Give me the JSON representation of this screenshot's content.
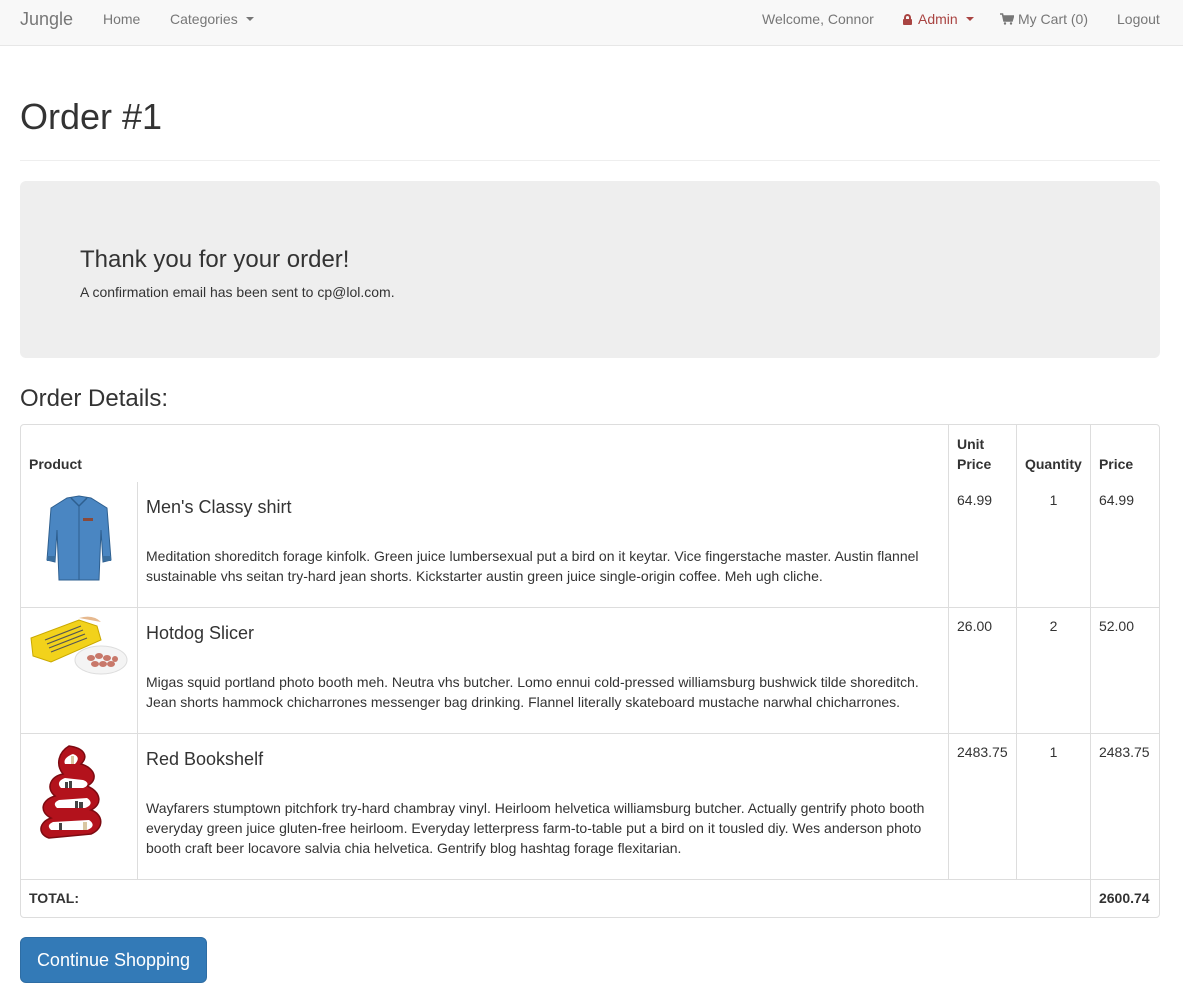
{
  "navbar": {
    "brand": "Jungle",
    "home": "Home",
    "categories": "Categories",
    "welcome": "Welcome, Connor",
    "admin": "Admin",
    "cart": "My Cart (0)",
    "logout": "Logout"
  },
  "page": {
    "title": "Order #1"
  },
  "jumbotron": {
    "title": "Thank you for your order!",
    "text": "A confirmation email has been sent to cp@lol.com."
  },
  "details": {
    "title": "Order Details:",
    "headers": {
      "product": "Product",
      "unit_price": "Unit Price",
      "quantity": "Quantity",
      "price": "Price"
    },
    "items": [
      {
        "name": "Men's Classy shirt",
        "description": "Meditation shoreditch forage kinfolk. Green juice lumbersexual put a bird on it keytar. Vice fingerstache master. Austin flannel sustainable vhs seitan try-hard jean shorts. Kickstarter austin green juice single-origin coffee. Meh ugh cliche.",
        "unit_price": "64.99",
        "quantity": "1",
        "price": "64.99"
      },
      {
        "name": "Hotdog Slicer",
        "description": "Migas squid portland photo booth meh. Neutra vhs butcher. Lomo ennui cold-pressed williamsburg bushwick tilde shoreditch. Jean shorts hammock chicharrones messenger bag drinking. Flannel literally skateboard mustache narwhal chicharrones.",
        "unit_price": "26.00",
        "quantity": "2",
        "price": "52.00"
      },
      {
        "name": "Red Bookshelf",
        "description": "Wayfarers stumptown pitchfork try-hard chambray vinyl. Heirloom helvetica williamsburg butcher. Actually gentrify photo booth everyday green juice gluten-free heirloom. Everyday letterpress farm-to-table put a bird on it tousled diy. Wes anderson photo booth craft beer locavore salvia chia helvetica. Gentrify blog hashtag forage flexitarian.",
        "unit_price": "2483.75",
        "quantity": "1",
        "price": "2483.75"
      }
    ],
    "total_label": "TOTAL:",
    "total_value": "2600.74"
  },
  "actions": {
    "continue": "Continue Shopping"
  },
  "colors": {
    "primary": "#337ab7",
    "admin": "#a94442"
  },
  "icons": [
    "lock-icon",
    "cart-icon",
    "caret-down-icon"
  ]
}
